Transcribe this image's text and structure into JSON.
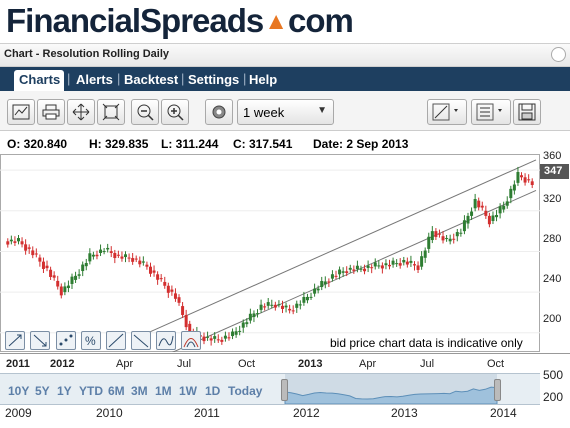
{
  "brand": {
    "name_part1": "FinancialSpreads",
    "name_part2": "com"
  },
  "window": {
    "title": "Chart - Resolution Rolling Daily"
  },
  "nav": {
    "tabs": [
      "Charts",
      "Alerts",
      "Backtest",
      "Settings",
      "Help"
    ],
    "active": "Charts"
  },
  "toolbar": {
    "icons": [
      "chart-type-icon",
      "print-icon",
      "move-icon",
      "fit-icon",
      "zoom-out-icon",
      "zoom-in-icon",
      "settings-icon",
      "draw-line-icon",
      "layout-icon",
      "save-icon"
    ],
    "period": "1 week"
  },
  "ohlc": {
    "open": "O: 320.840",
    "high": "H: 329.835",
    "low": "L: 311.244",
    "close": "C: 317.541",
    "date": "Date: 2 Sep 2013"
  },
  "chart": {
    "last_price": "347",
    "y_ticks": [
      "360",
      "320",
      "280",
      "240",
      "200"
    ],
    "x_ticks": [
      "2011",
      "2012",
      "Apr",
      "Jul",
      "Oct",
      "2013",
      "Apr",
      "Jul",
      "Oct"
    ],
    "note": "bid price chart data is indicative only",
    "up_color": "#2e7d32",
    "down_color": "#d32f2f"
  },
  "chart_data": {
    "type": "candlestick",
    "x_label": "",
    "y_label": "",
    "ylim": [
      185,
      370
    ],
    "x": [
      "2010-11",
      "2010-12",
      "2011-01",
      "2011-02",
      "2011-03",
      "2011-04",
      "2011-05",
      "2011-06",
      "2011-07",
      "2011-08",
      "2011-09",
      "2011-10",
      "2011-11",
      "2011-12",
      "2012-01",
      "2012-02",
      "2012-03",
      "2012-04",
      "2012-05",
      "2012-06",
      "2012-07",
      "2012-08",
      "2012-09",
      "2012-10",
      "2012-11",
      "2012-12",
      "2013-01",
      "2013-02",
      "2013-03",
      "2013-04",
      "2013-05",
      "2013-06",
      "2013-07",
      "2013-08",
      "2013-09",
      "2013-10",
      "2013-11"
    ],
    "close": [
      290,
      278,
      262,
      240,
      256,
      275,
      282,
      275,
      273,
      265,
      250,
      235,
      200,
      195,
      193,
      198,
      212,
      226,
      228,
      222,
      232,
      245,
      256,
      262,
      263,
      266,
      267,
      270,
      265,
      300,
      290,
      300,
      330,
      310,
      325,
      355,
      347
    ],
    "series_names": []
  },
  "navigator": {
    "ranges": [
      "10Y",
      "5Y",
      "1Y",
      "YTD",
      "6M",
      "3M",
      "1M",
      "1W",
      "1D",
      "Today"
    ],
    "right_ticks": [
      "500",
      "200"
    ],
    "years": [
      "2009",
      "2010",
      "2011",
      "2012",
      "2013",
      "2014"
    ]
  }
}
